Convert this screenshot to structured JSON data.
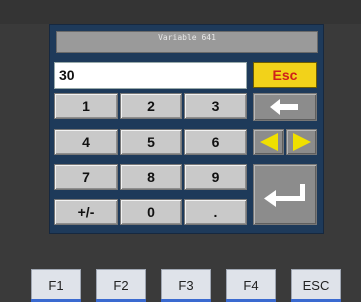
{
  "dialog": {
    "title": "Variable 641",
    "value": "30",
    "esc_label": "Esc"
  },
  "keypad": {
    "rows": [
      [
        "1",
        "2",
        "3"
      ],
      [
        "4",
        "5",
        "6"
      ],
      [
        "7",
        "8",
        "9"
      ],
      [
        "+/-",
        "0",
        "."
      ]
    ]
  },
  "function_keys": [
    "F1",
    "F2",
    "F3",
    "F4",
    "ESC"
  ],
  "colors": {
    "screen_bg": "#1e3a5a",
    "key_bg": "#c9c9c9",
    "esc_bg": "#f2d21a",
    "esc_text": "#d0201a",
    "arrow_yellow": "#f0e000"
  },
  "icons": [
    "backspace-arrow-icon",
    "left-arrow-icon",
    "right-arrow-icon",
    "enter-icon"
  ]
}
